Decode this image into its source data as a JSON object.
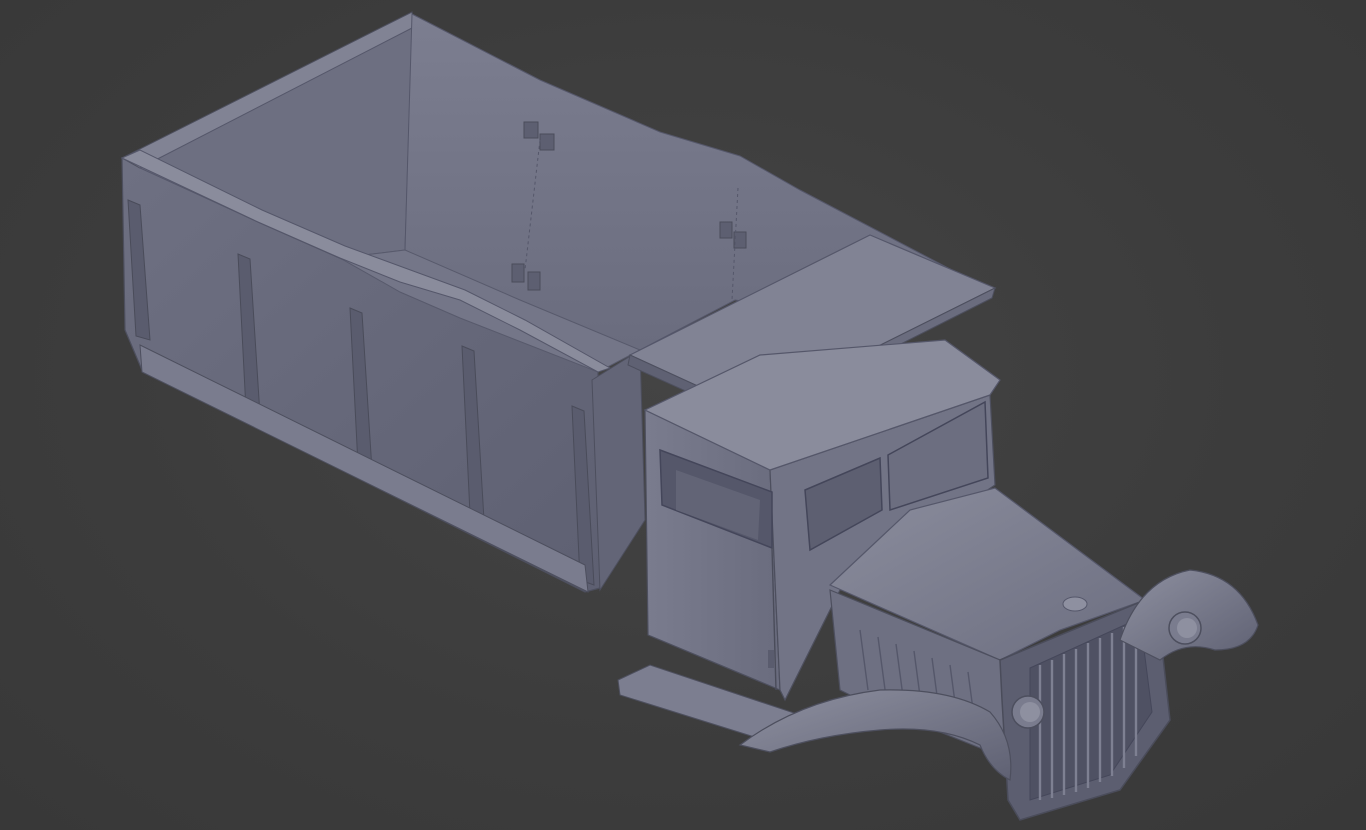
{
  "viewport": {
    "background_color": "#3d3d3d",
    "model_color": "#6b6d7f",
    "model_shadow_color": "#4a4c5a",
    "model_highlight_color": "#8a8c9c"
  },
  "scene": {
    "subject": "dump-truck-clay-render"
  }
}
